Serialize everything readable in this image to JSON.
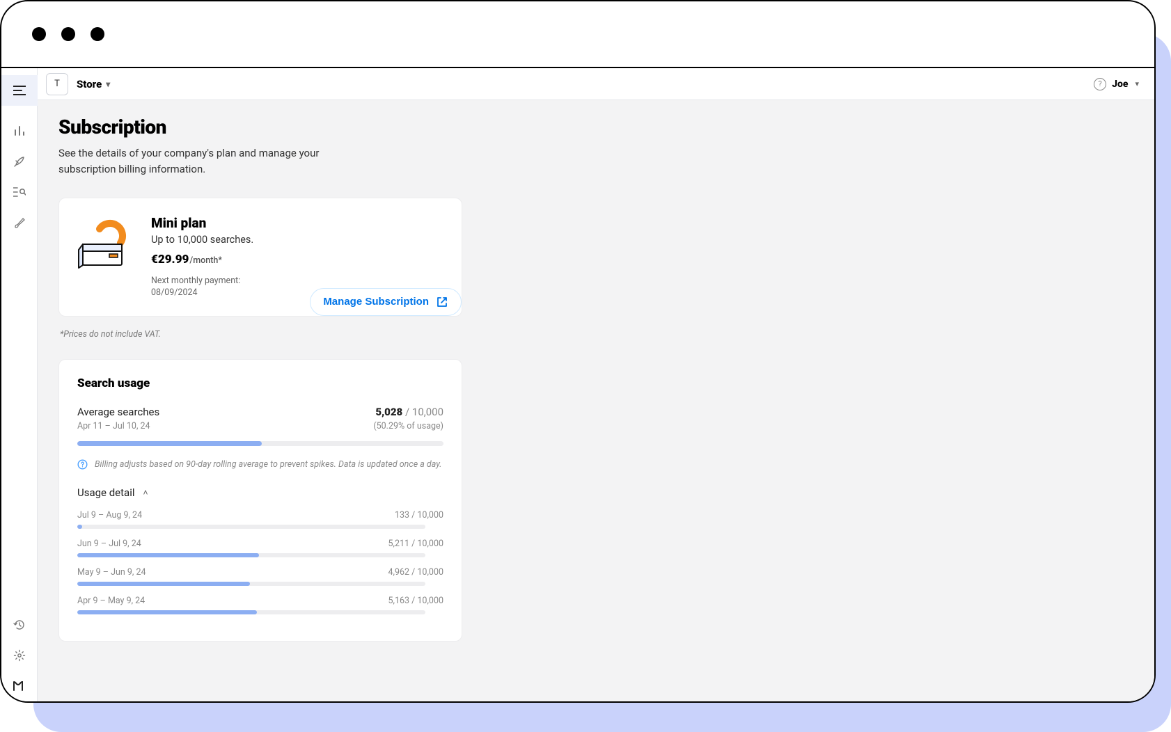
{
  "header": {
    "store_letter": "T",
    "store_label": "Store",
    "user_name": "Joe"
  },
  "page": {
    "title": "Subscription",
    "subtitle": "See the details of your company's plan and manage your subscription billing information."
  },
  "plan": {
    "name": "Mini plan",
    "description": "Up to 10,000 searches.",
    "price": "€29.99",
    "price_unit": "/month*",
    "next_payment_label": "Next monthly payment:",
    "next_payment_date": "08/09/2024",
    "manage_label": "Manage Subscription"
  },
  "vat_note": "*Prices do not include VAT.",
  "usage": {
    "title": "Search usage",
    "avg_label": "Average searches",
    "avg_period": "Apr 11 – Jul 10, 24",
    "avg_value": "5,028",
    "avg_limit": "10,000",
    "avg_percent_label": "(50.29% of usage)",
    "info_text": "Billing adjusts based on 90-day rolling average to prevent spikes. Data is updated once a day.",
    "detail_toggle": "Usage detail",
    "details": [
      {
        "period": "Jul 9 – Aug 9, 24",
        "value": "133",
        "limit": "10,000",
        "pct": 1.33
      },
      {
        "period": "Jun 9 – Jul 9, 24",
        "value": "5,211",
        "limit": "10,000",
        "pct": 52.11
      },
      {
        "period": "May 9 – Jun 9, 24",
        "value": "4,962",
        "limit": "10,000",
        "pct": 49.62
      },
      {
        "period": "Apr 9 – May 9, 24",
        "value": "5,163",
        "limit": "10,000",
        "pct": 51.63
      }
    ]
  },
  "chart_data": {
    "type": "bar",
    "title": "Search usage",
    "ylabel": "Searches",
    "ylim": [
      0,
      10000
    ],
    "categories": [
      "Apr 9 – May 9, 24",
      "May 9 – Jun 9, 24",
      "Jun 9 – Jul 9, 24",
      "Jul 9 – Aug 9, 24"
    ],
    "series": [
      {
        "name": "Searches",
        "values": [
          5163,
          4962,
          5211,
          133
        ]
      }
    ],
    "average": {
      "period": "Apr 11 – Jul 10, 24",
      "value": 5028,
      "limit": 10000,
      "percent": 50.29
    }
  }
}
